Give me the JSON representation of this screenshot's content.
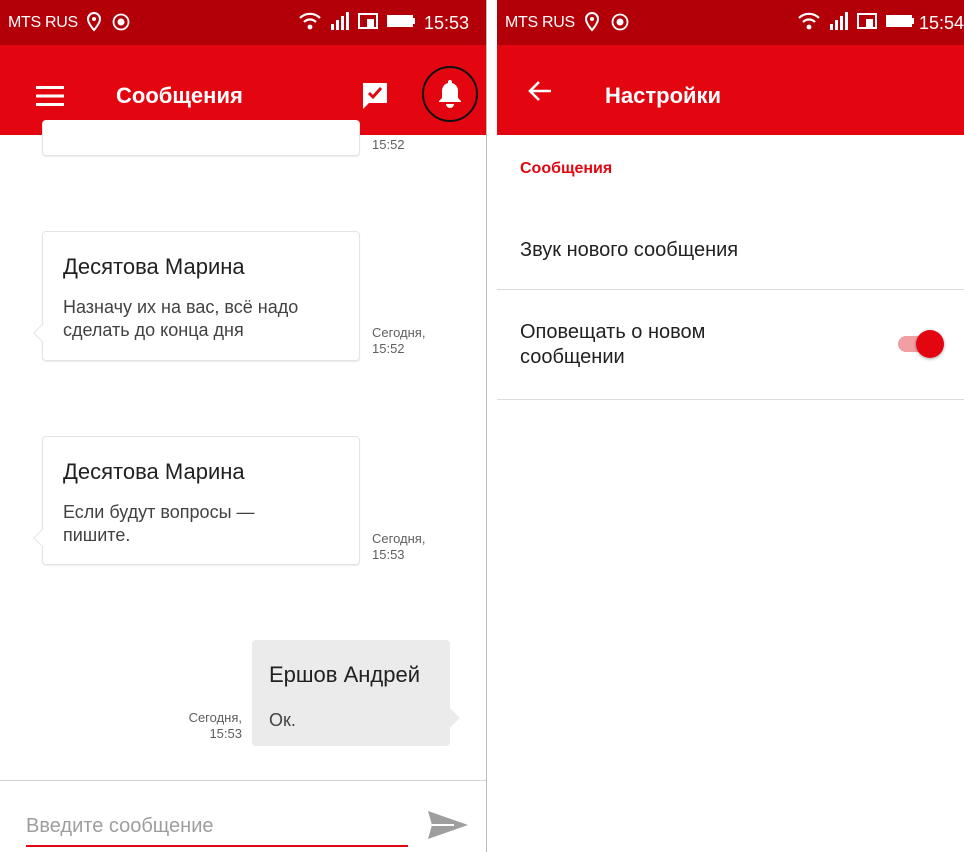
{
  "colors": {
    "brand": "#e30611",
    "status_bar": "#b30008",
    "switch_track": "#f29fa3"
  },
  "left_screen": {
    "status_bar": {
      "carrier": "MTS RUS",
      "time": "15:53"
    },
    "app_bar": {
      "title": "Сообщения",
      "icons": [
        "menu-icon",
        "chat-check-icon",
        "bell-icon"
      ]
    },
    "partial_message": {
      "time": "15:52"
    },
    "messages": [
      {
        "sender": "Десятова Марина",
        "lines": [
          "Назначу их на вас, всё надо",
          "сделать до конца дня"
        ],
        "time_line1": "Сегодня,",
        "time_line2": "15:52"
      },
      {
        "sender": "Десятова Марина",
        "lines": [
          "Если будут вопросы —",
          "пишите."
        ],
        "time_line1": "Сегодня,",
        "time_line2": "15:53"
      }
    ],
    "own_message": {
      "sender": "Ершов Андрей",
      "text": "Ок.",
      "time_line1": "Сегодня,",
      "time_line2": "15:53"
    },
    "composer": {
      "placeholder": "Введите сообщение",
      "value": ""
    }
  },
  "right_screen": {
    "status_bar": {
      "carrier": "MTS RUS",
      "time": "15:54"
    },
    "app_bar": {
      "title": "Настройки"
    },
    "section_title": "Сообщения",
    "settings": [
      {
        "label": "Звук нового сообщения"
      },
      {
        "label_line1": "Оповещать о новом",
        "label_line2": "сообщении",
        "enabled": true
      }
    ]
  }
}
